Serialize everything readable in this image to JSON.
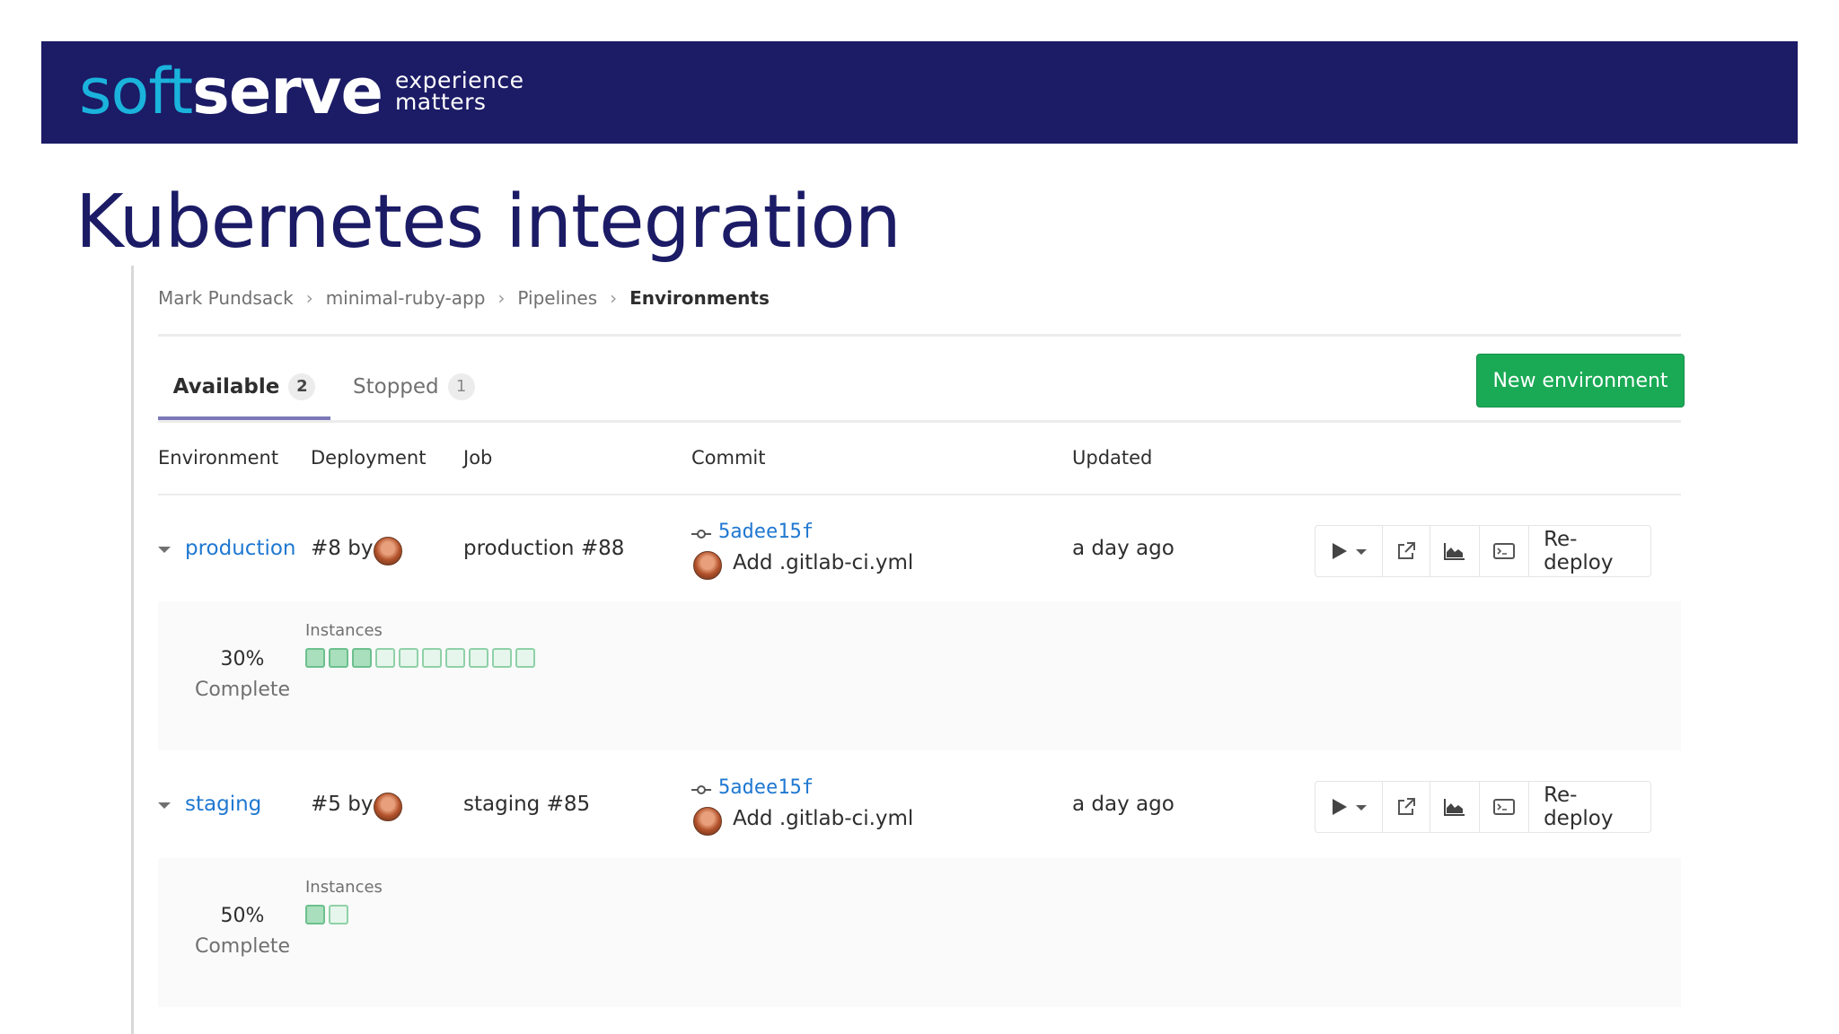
{
  "banner": {
    "logo_soft": "soft",
    "logo_serve": "serve",
    "tagline_1": "experience",
    "tagline_2": "matters"
  },
  "slide_title": "Kubernetes integration",
  "breadcrumb": [
    "Mark Pundsack",
    "minimal-ruby-app",
    "Pipelines",
    "Environments"
  ],
  "tabs": [
    {
      "label": "Available",
      "count": "2",
      "active": true
    },
    {
      "label": "Stopped",
      "count": "1",
      "active": false
    }
  ],
  "new_environment_label": "New environment",
  "columns": [
    "Environment",
    "Deployment",
    "Job",
    "Commit",
    "Updated"
  ],
  "environments": [
    {
      "name": "production",
      "deployment": "#8 by",
      "job": "production #88",
      "commit_sha": "5adee15f",
      "commit_message": "Add .gitlab-ci.yml",
      "updated": "a day ago",
      "action_label": "Re-deploy",
      "progress_percent": "30%",
      "progress_label": "Complete",
      "instances_label": "Instances",
      "instances_total": 10,
      "instances_ready": 3
    },
    {
      "name": "staging",
      "deployment": "#5 by",
      "job": "staging #85",
      "commit_sha": "5adee15f",
      "commit_message": "Add .gitlab-ci.yml",
      "updated": "a day ago",
      "action_label": "Re-deploy",
      "progress_percent": "50%",
      "progress_label": "Complete",
      "instances_label": "Instances",
      "instances_total": 2,
      "instances_ready": 1
    }
  ],
  "icons": [
    "play-icon",
    "chevron-down-icon",
    "external-link-icon",
    "monitoring-chart-icon",
    "terminal-icon",
    "commit-icon",
    "avatar"
  ],
  "colors": {
    "banner_bg": "#1b1b66",
    "logo_accent": "#1ab3dc",
    "title": "#1b1b66",
    "link": "#1f78d1",
    "primary_button": "#1aaa55",
    "active_tab_underline": "#7b79b8",
    "instance_fill": "#a9dfbd"
  }
}
